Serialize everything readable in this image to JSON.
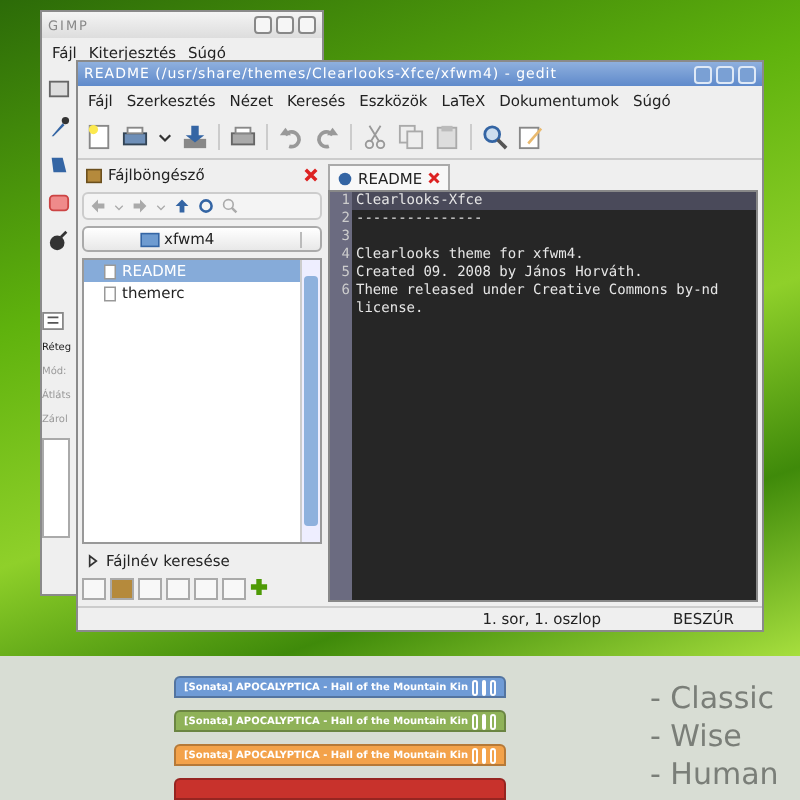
{
  "gimp_window": {
    "title": "GIMP",
    "menu": [
      "Fájl",
      "Kiterjesztés",
      "Súgó"
    ],
    "layer_labels": [
      {
        "text": "Réteg",
        "disabled": false
      },
      {
        "text": "Mód:",
        "disabled": true
      },
      {
        "text": "Átláts",
        "disabled": true
      },
      {
        "text": "Zárol",
        "disabled": true
      }
    ]
  },
  "gedit_window": {
    "title": "README (/usr/share/themes/Clearlooks-Xfce/xfwm4) - gedit",
    "menu": [
      "Fájl",
      "Szerkesztés",
      "Nézet",
      "Keresés",
      "Eszközök",
      "LaTeX",
      "Dokumentumok",
      "Súgó"
    ],
    "side_panel": {
      "title": "Fájlböngésző",
      "folder": "xfwm4",
      "files": [
        {
          "name": "README",
          "selected": true
        },
        {
          "name": "themerc",
          "selected": false
        }
      ],
      "search_label": "Fájlnév keresése"
    },
    "tabs": [
      {
        "label": "README",
        "selected": true
      }
    ],
    "lines": [
      {
        "number": "1",
        "text": "Clearlooks-Xfce",
        "current": true
      },
      {
        "number": "2",
        "text": "---------------",
        "current": false
      },
      {
        "number": "3",
        "current": false
      },
      {
        "number": "4",
        "text": "Clearlooks theme for xfwm4.",
        "current": false
      },
      {
        "number": "5",
        "text": "Created 09. 2008 by János Horváth.",
        "current": false
      },
      {
        "number": "6",
        "text": "Theme released under Creative Commons by-nd license.",
        "current": false
      }
    ],
    "status_bar": {
      "position": "1. sor, 1. oszlop",
      "mode": "BESZÚR"
    }
  },
  "theme_previews": {
    "windows": [
      {
        "title": "[Sonata] APOCALYPTICA - Hall of the Mountain Kin",
        "color": "#6f9bd6"
      },
      {
        "title": "[Sonata] APOCALYPTICA - Hall of the Mountain Kin",
        "color": "#8fb258"
      },
      {
        "title": "[Sonata] APOCALYPTICA - Hall of the Mountain Kin",
        "color": "#f3a24a"
      },
      {
        "color": "#c8322c"
      }
    ],
    "styles": [
      "- Classic",
      "- Wise",
      "- Human"
    ]
  }
}
